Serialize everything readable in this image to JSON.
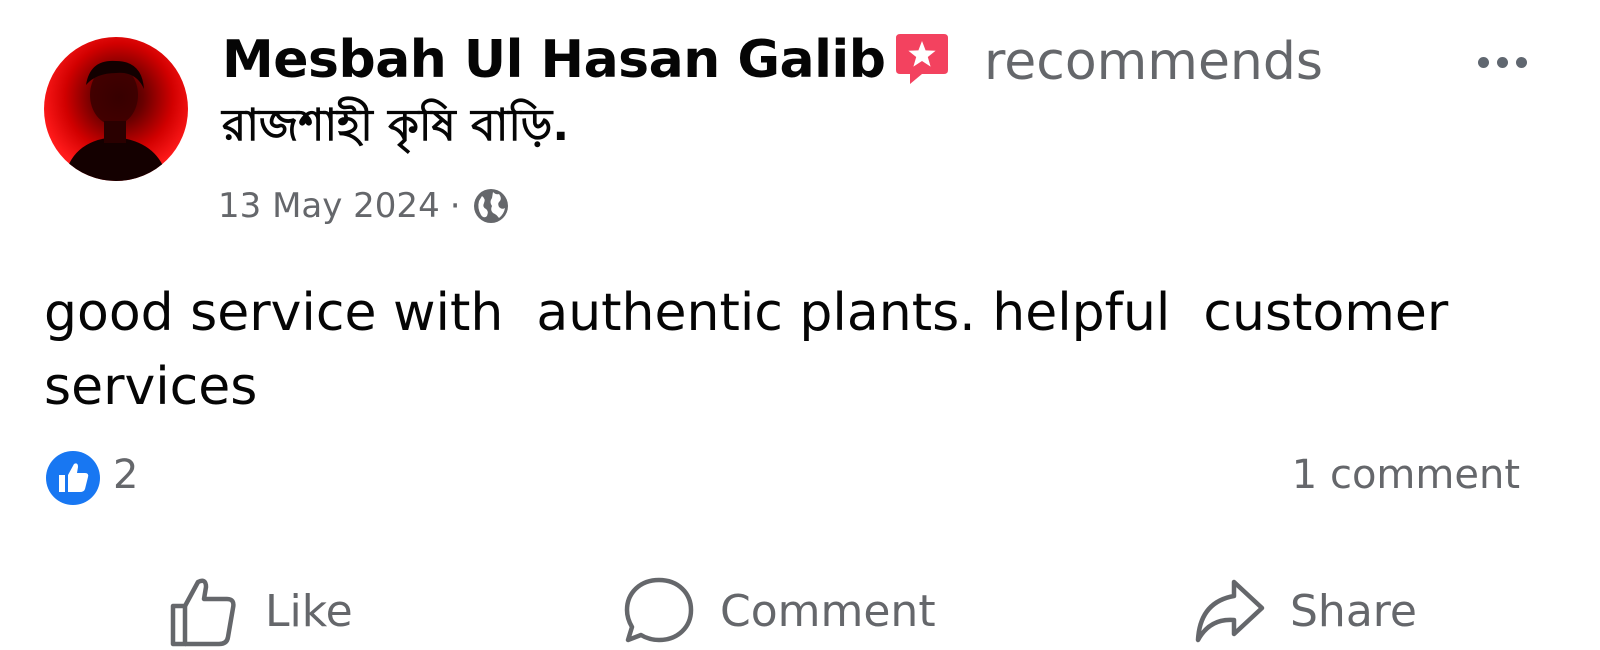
{
  "post": {
    "author_name": "Mesbah Ul Hasan Galib",
    "action_text": "recommends",
    "page_name": "রাজশাহী কৃষি বাড়ি.",
    "date": "13 May 2024",
    "separator": "·",
    "privacy_icon": "globe-icon",
    "body": "good service with  authentic plants. helpful  customer services"
  },
  "engagement": {
    "reaction_icon": "like-reaction-icon",
    "reaction_count": "2",
    "comments_label": "1 comment"
  },
  "actions": {
    "like_label": "Like",
    "comment_label": "Comment",
    "share_label": "Share"
  },
  "colors": {
    "primary_text": "#050505",
    "secondary_text": "#65676b",
    "like_blue": "#1877f2",
    "badge_pink": "#f3425f"
  }
}
